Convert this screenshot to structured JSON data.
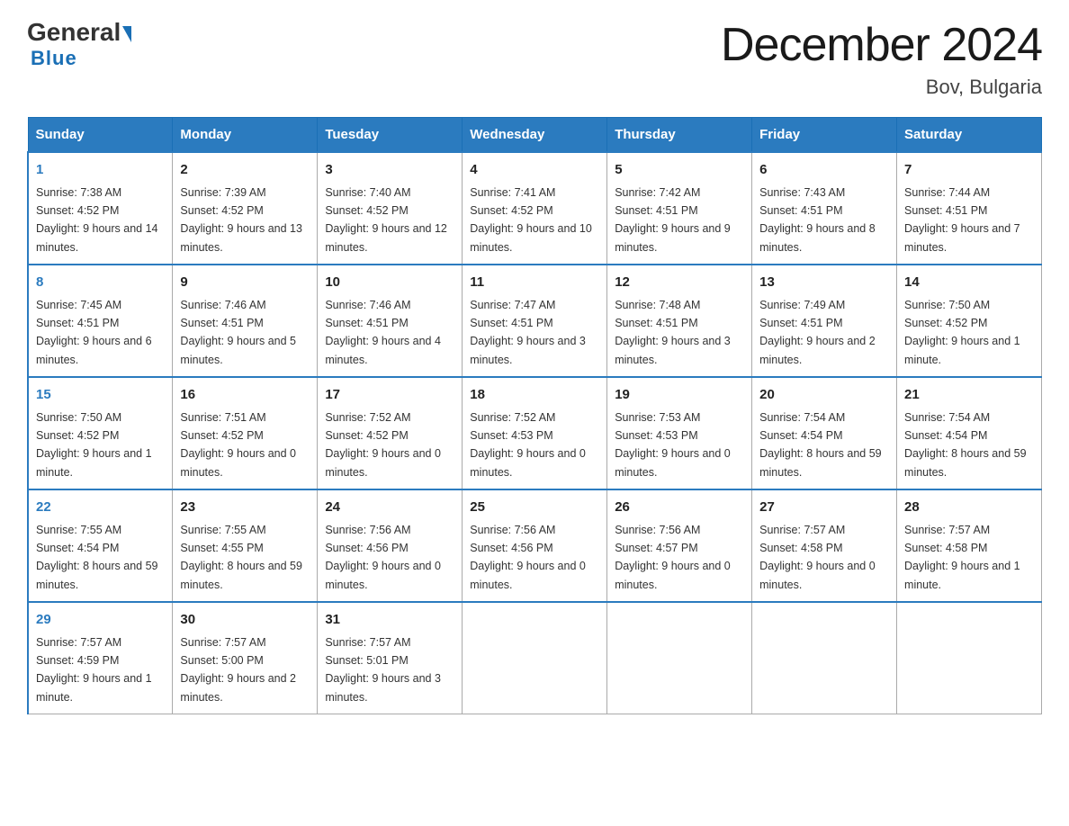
{
  "logo": {
    "general": "General",
    "blue": "Blue"
  },
  "title": "December 2024",
  "location": "Bov, Bulgaria",
  "days_header": [
    "Sunday",
    "Monday",
    "Tuesday",
    "Wednesday",
    "Thursday",
    "Friday",
    "Saturday"
  ],
  "weeks": [
    [
      {
        "day": "1",
        "sunrise": "7:38 AM",
        "sunset": "4:52 PM",
        "daylight": "9 hours and 14 minutes."
      },
      {
        "day": "2",
        "sunrise": "7:39 AM",
        "sunset": "4:52 PM",
        "daylight": "9 hours and 13 minutes."
      },
      {
        "day": "3",
        "sunrise": "7:40 AM",
        "sunset": "4:52 PM",
        "daylight": "9 hours and 12 minutes."
      },
      {
        "day": "4",
        "sunrise": "7:41 AM",
        "sunset": "4:52 PM",
        "daylight": "9 hours and 10 minutes."
      },
      {
        "day": "5",
        "sunrise": "7:42 AM",
        "sunset": "4:51 PM",
        "daylight": "9 hours and 9 minutes."
      },
      {
        "day": "6",
        "sunrise": "7:43 AM",
        "sunset": "4:51 PM",
        "daylight": "9 hours and 8 minutes."
      },
      {
        "day": "7",
        "sunrise": "7:44 AM",
        "sunset": "4:51 PM",
        "daylight": "9 hours and 7 minutes."
      }
    ],
    [
      {
        "day": "8",
        "sunrise": "7:45 AM",
        "sunset": "4:51 PM",
        "daylight": "9 hours and 6 minutes."
      },
      {
        "day": "9",
        "sunrise": "7:46 AM",
        "sunset": "4:51 PM",
        "daylight": "9 hours and 5 minutes."
      },
      {
        "day": "10",
        "sunrise": "7:46 AM",
        "sunset": "4:51 PM",
        "daylight": "9 hours and 4 minutes."
      },
      {
        "day": "11",
        "sunrise": "7:47 AM",
        "sunset": "4:51 PM",
        "daylight": "9 hours and 3 minutes."
      },
      {
        "day": "12",
        "sunrise": "7:48 AM",
        "sunset": "4:51 PM",
        "daylight": "9 hours and 3 minutes."
      },
      {
        "day": "13",
        "sunrise": "7:49 AM",
        "sunset": "4:51 PM",
        "daylight": "9 hours and 2 minutes."
      },
      {
        "day": "14",
        "sunrise": "7:50 AM",
        "sunset": "4:52 PM",
        "daylight": "9 hours and 1 minute."
      }
    ],
    [
      {
        "day": "15",
        "sunrise": "7:50 AM",
        "sunset": "4:52 PM",
        "daylight": "9 hours and 1 minute."
      },
      {
        "day": "16",
        "sunrise": "7:51 AM",
        "sunset": "4:52 PM",
        "daylight": "9 hours and 0 minutes."
      },
      {
        "day": "17",
        "sunrise": "7:52 AM",
        "sunset": "4:52 PM",
        "daylight": "9 hours and 0 minutes."
      },
      {
        "day": "18",
        "sunrise": "7:52 AM",
        "sunset": "4:53 PM",
        "daylight": "9 hours and 0 minutes."
      },
      {
        "day": "19",
        "sunrise": "7:53 AM",
        "sunset": "4:53 PM",
        "daylight": "9 hours and 0 minutes."
      },
      {
        "day": "20",
        "sunrise": "7:54 AM",
        "sunset": "4:54 PM",
        "daylight": "8 hours and 59 minutes."
      },
      {
        "day": "21",
        "sunrise": "7:54 AM",
        "sunset": "4:54 PM",
        "daylight": "8 hours and 59 minutes."
      }
    ],
    [
      {
        "day": "22",
        "sunrise": "7:55 AM",
        "sunset": "4:54 PM",
        "daylight": "8 hours and 59 minutes."
      },
      {
        "day": "23",
        "sunrise": "7:55 AM",
        "sunset": "4:55 PM",
        "daylight": "8 hours and 59 minutes."
      },
      {
        "day": "24",
        "sunrise": "7:56 AM",
        "sunset": "4:56 PM",
        "daylight": "9 hours and 0 minutes."
      },
      {
        "day": "25",
        "sunrise": "7:56 AM",
        "sunset": "4:56 PM",
        "daylight": "9 hours and 0 minutes."
      },
      {
        "day": "26",
        "sunrise": "7:56 AM",
        "sunset": "4:57 PM",
        "daylight": "9 hours and 0 minutes."
      },
      {
        "day": "27",
        "sunrise": "7:57 AM",
        "sunset": "4:58 PM",
        "daylight": "9 hours and 0 minutes."
      },
      {
        "day": "28",
        "sunrise": "7:57 AM",
        "sunset": "4:58 PM",
        "daylight": "9 hours and 1 minute."
      }
    ],
    [
      {
        "day": "29",
        "sunrise": "7:57 AM",
        "sunset": "4:59 PM",
        "daylight": "9 hours and 1 minute."
      },
      {
        "day": "30",
        "sunrise": "7:57 AM",
        "sunset": "5:00 PM",
        "daylight": "9 hours and 2 minutes."
      },
      {
        "day": "31",
        "sunrise": "7:57 AM",
        "sunset": "5:01 PM",
        "daylight": "9 hours and 3 minutes."
      },
      null,
      null,
      null,
      null
    ]
  ],
  "labels": {
    "sunrise": "Sunrise:",
    "sunset": "Sunset:",
    "daylight": "Daylight:"
  }
}
